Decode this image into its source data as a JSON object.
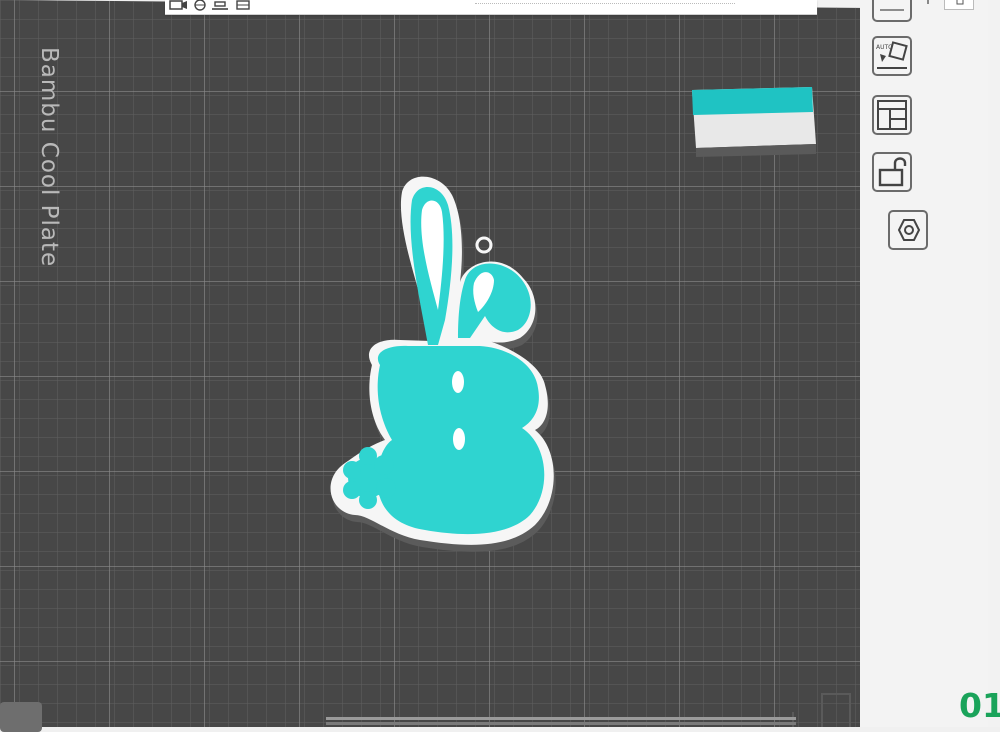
{
  "plate": {
    "label": "Bambu Cool Plate"
  },
  "status": {
    "layer_indicator": "01"
  },
  "colors": {
    "plate": "#464646",
    "grid_minor": "#626262",
    "grid_major": "#8a8a8a",
    "model_teal": "#2fd4d0",
    "model_white": "#f4f4f4",
    "filament_teal": "#1fc0c0",
    "filament_white": "#e6e6e6"
  },
  "toolbar": {
    "top_icons": [
      "camera-icon",
      "globe-icon",
      "align-icon",
      "layers-icon"
    ],
    "side_icons": [
      "auto-orient-icon",
      "arrange-icon",
      "lock-icon",
      "hexagon-icon"
    ]
  },
  "model": {
    "letter": "B",
    "style": "bunny-ears keychain"
  }
}
